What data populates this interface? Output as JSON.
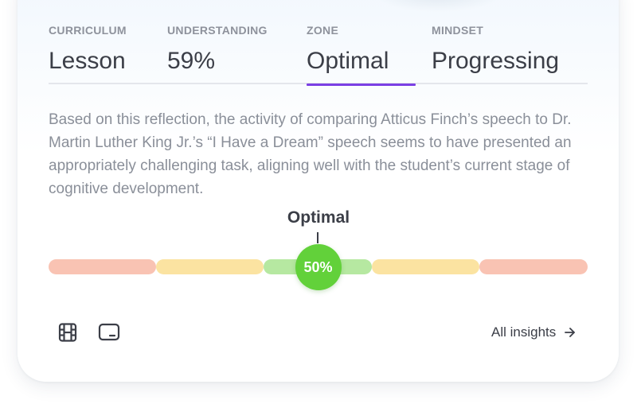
{
  "stats": [
    {
      "label": "CURRICULUM",
      "value": "Lesson",
      "active": false
    },
    {
      "label": "UNDERSTANDING",
      "value": "59%",
      "active": false
    },
    {
      "label": "ZONE",
      "value": "Optimal",
      "active": true
    },
    {
      "label": "MINDSET",
      "value": "Progressing",
      "active": false
    }
  ],
  "description": "Based on this reflection, the activity of comparing Atticus Finch’s speech to Dr. Martin Luther King Jr.’s “I Have a Dream” speech seems to have presented an appropriately challenging task, aligning well with the student’s current stage of cognitive development.",
  "meter": {
    "zone_label": "Optimal",
    "value_label": "50%",
    "value": 0.5,
    "segment_colors": [
      "#f9c3b3",
      "#fbe3a1",
      "#b6e8a1",
      "#fbe3a1",
      "#f9c3b3"
    ],
    "knob_color": "#62d13a"
  },
  "footer": {
    "icons": [
      "film-icon",
      "tablet-icon"
    ],
    "all_insights_label": "All insights"
  },
  "colors": {
    "accent": "#7b3fe4",
    "text_dark": "#3b3e47",
    "text_muted": "#8a8f99"
  }
}
